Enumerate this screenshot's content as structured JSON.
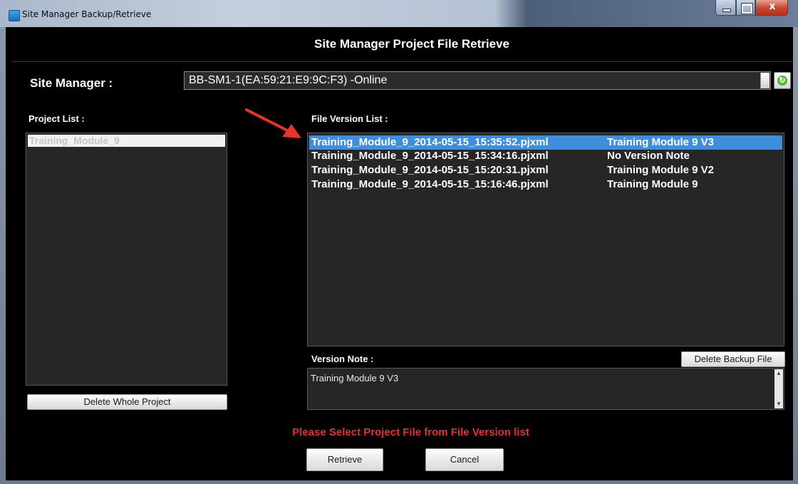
{
  "window": {
    "title": "Site Manager Backup/Retrieve",
    "close_glyph": "x"
  },
  "dialog": {
    "heading": "Site Manager Project File Retrieve"
  },
  "site_manager": {
    "label": "Site Manager :",
    "selected": "BB-SM1-1(EA:59:21:E9:9C:F3) -Online",
    "refresh_icon": "refresh-icon"
  },
  "project_list": {
    "label": "Project List :",
    "items": [
      "Training_Module_9"
    ],
    "delete_label": "Delete Whole Project"
  },
  "file_version_list": {
    "label": "File Version List :",
    "selected_index": 0,
    "rows": [
      {
        "file": "Training_Module_9_2014-05-15_15:35:52.pjxml",
        "note": "Training Module 9 V3"
      },
      {
        "file": "Training_Module_9_2014-05-15_15:34:16.pjxml",
        "note": "No Version Note"
      },
      {
        "file": "Training_Module_9_2014-05-15_15:20:31.pjxml",
        "note": "Training Module 9 V2"
      },
      {
        "file": "Training_Module_9_2014-05-15_15:16:46.pjxml",
        "note": "Training Module 9"
      }
    ]
  },
  "version_note": {
    "label": "Version Note :",
    "text": "Training Module 9 V3",
    "delete_backup_label": "Delete Backup File"
  },
  "status": {
    "message": "Please Select Project File from File Version list"
  },
  "buttons": {
    "retrieve": "Retrieve",
    "cancel": "Cancel"
  },
  "colors": {
    "selection": "#3e8edb",
    "warning": "#e53030",
    "annotation_arrow": "#e8322a"
  }
}
